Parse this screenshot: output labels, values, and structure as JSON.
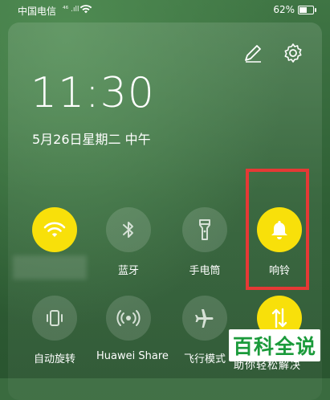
{
  "status_bar": {
    "carrier": "中国电信",
    "signal_text": "⁴⁶ .ıll",
    "battery_percent": "62%",
    "battery_level": 0.62
  },
  "header": {
    "time": "11:30",
    "date": "5月26日星期二 中午"
  },
  "tiles": [
    {
      "name": "wifi",
      "label": "",
      "on": true,
      "icon": "wifi-icon"
    },
    {
      "name": "bluetooth",
      "label": "蓝牙",
      "on": false,
      "icon": "bluetooth-icon"
    },
    {
      "name": "flashlight",
      "label": "手电筒",
      "on": false,
      "icon": "flashlight-icon"
    },
    {
      "name": "ring",
      "label": "响铃",
      "on": true,
      "icon": "bell-icon"
    },
    {
      "name": "auto-rotate",
      "label": "自动旋转",
      "on": false,
      "icon": "rotate-icon"
    },
    {
      "name": "huawei-share",
      "label": "Huawei Share",
      "on": false,
      "icon": "share-icon"
    },
    {
      "name": "airplane",
      "label": "飞行模式",
      "on": false,
      "icon": "airplane-icon"
    },
    {
      "name": "mobile-data",
      "label": "",
      "on": true,
      "icon": "mobile-data-icon"
    }
  ],
  "colors": {
    "accent_on": "#f8e00a",
    "highlight": "#e53935"
  },
  "watermark": {
    "main": "百科全说",
    "sub": "助你轻松解决"
  }
}
